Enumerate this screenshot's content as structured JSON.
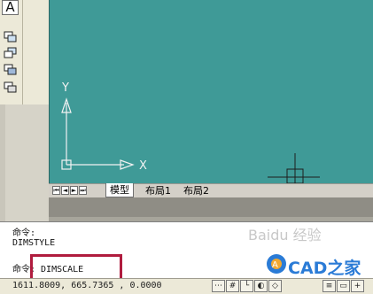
{
  "toolbar": {
    "text_tool_label": "A"
  },
  "tabs": {
    "nav_first": "⏮",
    "nav_prev": "◄",
    "nav_next": "►",
    "nav_last": "⏭",
    "model": "模型",
    "layout1": "布局1",
    "layout2": "布局2"
  },
  "ucs": {
    "y_label": "Y",
    "x_label": "X"
  },
  "command": {
    "line1": "命令:",
    "line2": "DIMSTYLE",
    "line3": "命令: DIMSCALE"
  },
  "status": {
    "coords": "1611.8009, 665.7365 , 0.0000"
  },
  "watermark": {
    "baidu": "Baidu 经验",
    "cad": "CAD之家"
  },
  "colors": {
    "viewport": "#3f9a97",
    "highlight": "#b01c3e",
    "cad_logo": "#2a7bd6"
  }
}
